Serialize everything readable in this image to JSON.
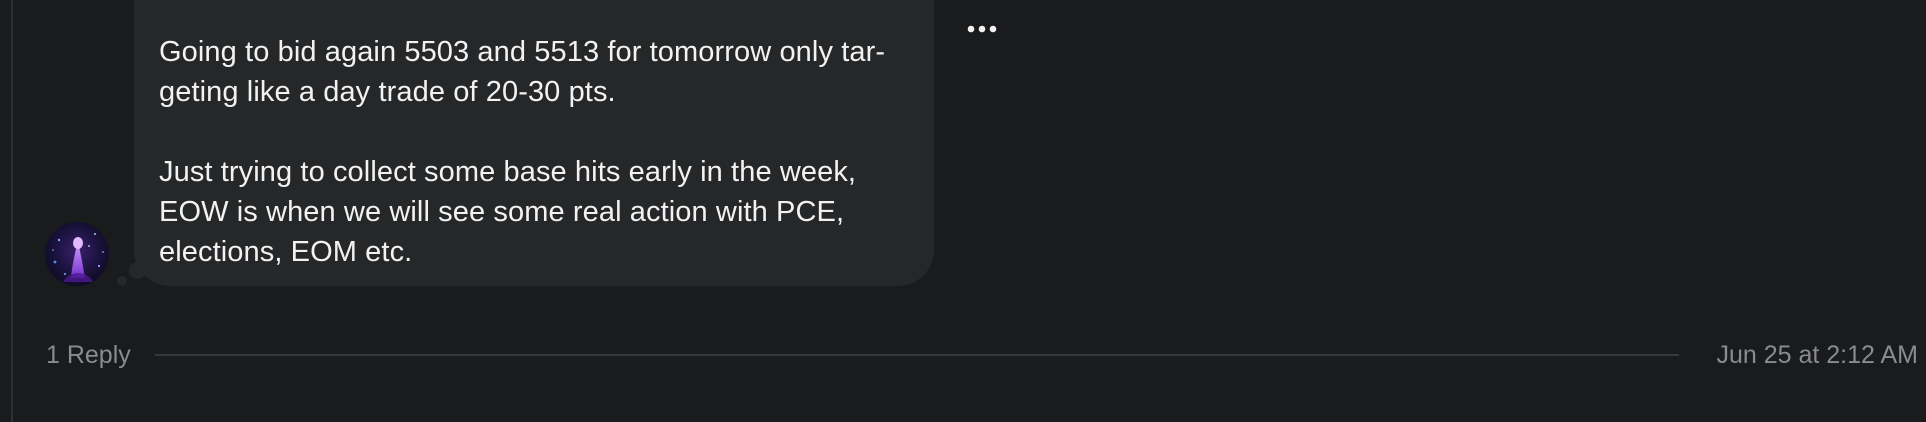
{
  "message": {
    "paragraphs": [
      "Going to bid again 5503 and 5513 for tomorrow only tar-\ngeting like a day trade of 20-30 pts.",
      "Just trying to collect some base hits early in the week,\nEOW is when we will see some real action with PCE,\nelections, EOM etc."
    ],
    "more_icon": "more-horizontal-icon",
    "avatar_icon": "user-avatar-image"
  },
  "footer": {
    "reply_count_label": "1 Reply",
    "timestamp": "Jun 25 at 2:12 AM"
  },
  "colors": {
    "background": "#1a1b1d",
    "bubble": "#262728",
    "text_primary": "#f2f2f2",
    "text_secondary": "#8a8b8e",
    "divider": "#37383b"
  }
}
